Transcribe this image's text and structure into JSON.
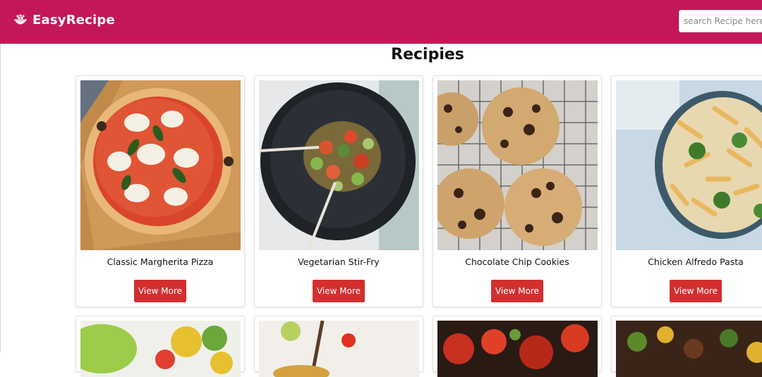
{
  "brand": {
    "name": "EasyRecipe",
    "icon": "bowl-icon"
  },
  "search": {
    "placeholder": "search Recipe here...",
    "value": ""
  },
  "main": {
    "heading": "Recipies"
  },
  "recipes": [
    {
      "title": "Classic Margherita Pizza",
      "button_label": "View More",
      "image": "margherita-pizza-photo"
    },
    {
      "title": "Vegetarian Stir-Fry",
      "button_label": "View More",
      "image": "vegetable-stir-fry-photo"
    },
    {
      "title": "Chocolate Chip Cookies",
      "button_label": "View More",
      "image": "chocolate-chip-cookies-photo"
    },
    {
      "title": "Chicken Alfredo Pasta",
      "button_label": "View More",
      "image": "chicken-alfredo-pasta-photo"
    }
  ],
  "recipes_partial_row": [
    {
      "image": "salad-photo"
    },
    {
      "image": "soup-photo"
    },
    {
      "image": "bruschetta-photo"
    },
    {
      "image": "beef-stir-fry-photo"
    }
  ],
  "colors": {
    "navbar": "#c2185b",
    "button": "#d32f2f",
    "background": "#ffffff"
  }
}
